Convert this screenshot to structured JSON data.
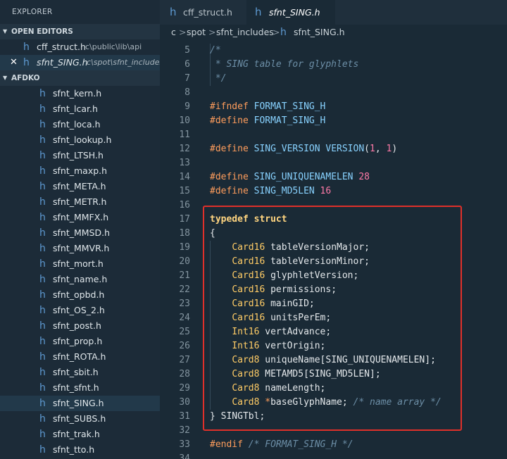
{
  "sidebar": {
    "title": "EXPLORER",
    "open_editors": {
      "header": "OPEN EDITORS",
      "items": [
        {
          "name": "cff_struct.h",
          "path": "c\\public\\lib\\api",
          "icon": "h-file-icon"
        },
        {
          "name": "sfnt_SING.h",
          "path": "c\\spot\\sfnt_includes",
          "icon": "h-file-icon"
        }
      ]
    },
    "project": {
      "header": "AFDKO",
      "files": [
        "sfnt_kern.h",
        "sfnt_lcar.h",
        "sfnt_loca.h",
        "sfnt_lookup.h",
        "sfnt_LTSH.h",
        "sfnt_maxp.h",
        "sfnt_META.h",
        "sfnt_METR.h",
        "sfnt_MMFX.h",
        "sfnt_MMSD.h",
        "sfnt_MMVR.h",
        "sfnt_mort.h",
        "sfnt_name.h",
        "sfnt_opbd.h",
        "sfnt_OS_2.h",
        "sfnt_post.h",
        "sfnt_prop.h",
        "sfnt_ROTA.h",
        "sfnt_sbit.h",
        "sfnt_sfnt.h",
        "sfnt_SING.h",
        "sfnt_SUBS.h",
        "sfnt_trak.h",
        "sfnt_tto.h"
      ],
      "active_file": "sfnt_SING.h"
    }
  },
  "tabs": [
    {
      "label": "cff_struct.h",
      "icon": "h-file-icon"
    },
    {
      "label": "sfnt_SING.h",
      "icon": "h-file-icon"
    }
  ],
  "breadcrumb": {
    "parts": [
      "c",
      "spot",
      "sfnt_includes"
    ],
    "file": "sfnt_SING.h",
    "separator": ">"
  },
  "editor": {
    "lines": [
      {
        "n": "5",
        "tokens": [
          [
            "comment",
            "/*"
          ]
        ]
      },
      {
        "n": "6",
        "tokens": [
          [
            "comment",
            " * SING table for glyphlets"
          ]
        ]
      },
      {
        "n": "7",
        "tokens": [
          [
            "comment",
            " */"
          ]
        ]
      },
      {
        "n": "8",
        "tokens": []
      },
      {
        "n": "9",
        "tokens": [
          [
            "pre",
            "#ifndef "
          ],
          [
            "macro",
            "FORMAT_SING_H"
          ]
        ]
      },
      {
        "n": "10",
        "tokens": [
          [
            "pre",
            "#define "
          ],
          [
            "macro",
            "FORMAT_SING_H"
          ]
        ]
      },
      {
        "n": "11",
        "tokens": []
      },
      {
        "n": "12",
        "tokens": [
          [
            "pre",
            "#define "
          ],
          [
            "macro",
            "SING_VERSION VERSION"
          ],
          [
            "punct",
            "("
          ],
          [
            "num",
            "1"
          ],
          [
            "punct",
            ", "
          ],
          [
            "num",
            "1"
          ],
          [
            "punct",
            ")"
          ]
        ]
      },
      {
        "n": "13",
        "tokens": []
      },
      {
        "n": "14",
        "tokens": [
          [
            "pre",
            "#define "
          ],
          [
            "macro",
            "SING_UNIQUENAMELEN "
          ],
          [
            "num",
            "28"
          ]
        ]
      },
      {
        "n": "15",
        "tokens": [
          [
            "pre",
            "#define "
          ],
          [
            "macro",
            "SING_MD5LEN "
          ],
          [
            "num",
            "16"
          ]
        ]
      },
      {
        "n": "16",
        "tokens": []
      },
      {
        "n": "17",
        "tokens": [
          [
            "keyword",
            "typedef struct"
          ]
        ]
      },
      {
        "n": "18",
        "tokens": [
          [
            "punct",
            "{"
          ]
        ]
      },
      {
        "n": "19",
        "tokens": [
          [
            "ident",
            "    "
          ],
          [
            "type",
            "Card16"
          ],
          [
            "ident",
            " tableVersionMajor;"
          ]
        ]
      },
      {
        "n": "20",
        "tokens": [
          [
            "ident",
            "    "
          ],
          [
            "type",
            "Card16"
          ],
          [
            "ident",
            " tableVersionMinor;"
          ]
        ]
      },
      {
        "n": "21",
        "tokens": [
          [
            "ident",
            "    "
          ],
          [
            "type",
            "Card16"
          ],
          [
            "ident",
            " glyphletVersion;"
          ]
        ]
      },
      {
        "n": "22",
        "tokens": [
          [
            "ident",
            "    "
          ],
          [
            "type",
            "Card16"
          ],
          [
            "ident",
            " permissions;"
          ]
        ]
      },
      {
        "n": "23",
        "tokens": [
          [
            "ident",
            "    "
          ],
          [
            "type",
            "Card16"
          ],
          [
            "ident",
            " mainGID;"
          ]
        ]
      },
      {
        "n": "24",
        "tokens": [
          [
            "ident",
            "    "
          ],
          [
            "type",
            "Card16"
          ],
          [
            "ident",
            " unitsPerEm;"
          ]
        ]
      },
      {
        "n": "25",
        "tokens": [
          [
            "ident",
            "    "
          ],
          [
            "type",
            "Int16"
          ],
          [
            "ident",
            " vertAdvance;"
          ]
        ]
      },
      {
        "n": "26",
        "tokens": [
          [
            "ident",
            "    "
          ],
          [
            "type",
            "Int16"
          ],
          [
            "ident",
            " vertOrigin;"
          ]
        ]
      },
      {
        "n": "27",
        "tokens": [
          [
            "ident",
            "    "
          ],
          [
            "type",
            "Card8"
          ],
          [
            "ident",
            " uniqueName[SING_UNIQUENAMELEN];"
          ]
        ]
      },
      {
        "n": "28",
        "tokens": [
          [
            "ident",
            "    "
          ],
          [
            "type",
            "Card8"
          ],
          [
            "ident",
            " METAMD5[SING_MD5LEN];"
          ]
        ]
      },
      {
        "n": "29",
        "tokens": [
          [
            "ident",
            "    "
          ],
          [
            "type",
            "Card8"
          ],
          [
            "ident",
            " nameLength;"
          ]
        ]
      },
      {
        "n": "30",
        "tokens": [
          [
            "ident",
            "    "
          ],
          [
            "type",
            "Card8"
          ],
          [
            "ident",
            " "
          ],
          [
            "ptr",
            "*"
          ],
          [
            "ident",
            "baseGlyphName; "
          ],
          [
            "comment",
            "/* name array */"
          ]
        ]
      },
      {
        "n": "31",
        "tokens": [
          [
            "punct",
            "} "
          ],
          [
            "ident",
            "SINGTbl;"
          ]
        ]
      },
      {
        "n": "32",
        "tokens": []
      },
      {
        "n": "33",
        "tokens": [
          [
            "pre",
            "#endif "
          ],
          [
            "comment",
            "/* FORMAT_SING_H */"
          ]
        ]
      },
      {
        "n": "34",
        "tokens": []
      }
    ]
  },
  "colors": {
    "sidebar_bg": "#1c2b38",
    "editor_bg": "#1a2a36",
    "accent_blue": "#5e9ad2",
    "highlight_box": "#e0302a"
  }
}
